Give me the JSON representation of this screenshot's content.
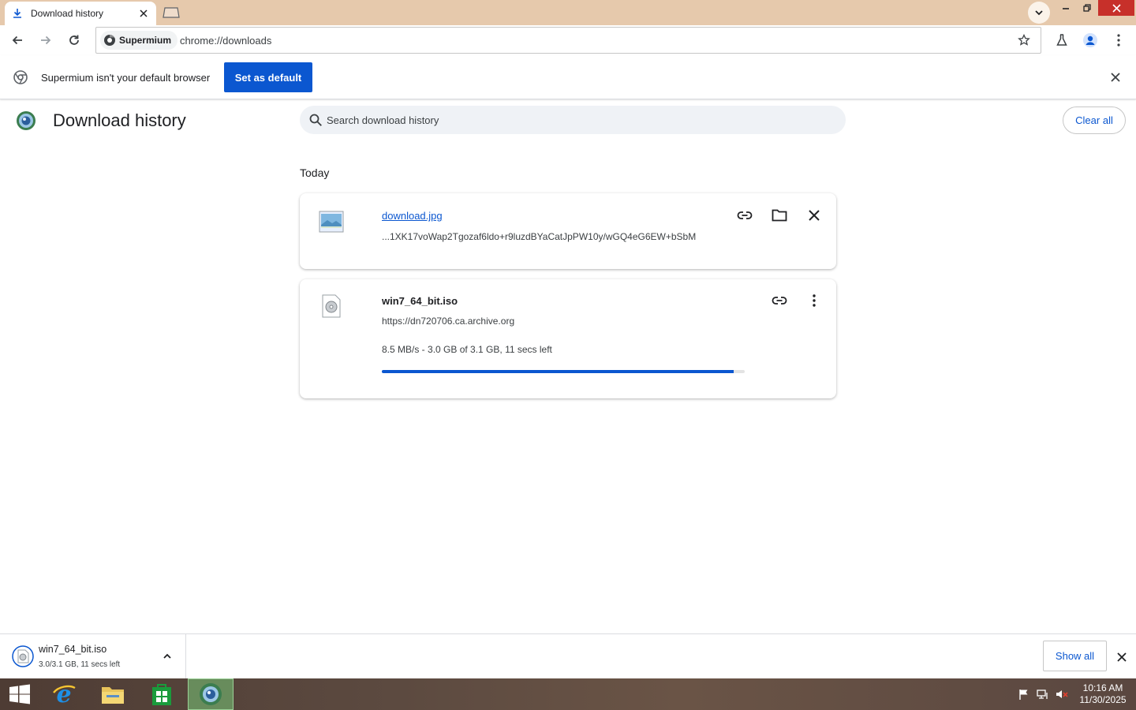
{
  "browser": {
    "tab": {
      "title": "Download history"
    },
    "omnibox": {
      "chip_label": "Supermium",
      "url": "chrome://downloads"
    }
  },
  "infobar": {
    "message": "Supermium isn't your default browser",
    "button_label": "Set as default"
  },
  "page": {
    "title": "Download history",
    "search_placeholder": "Search download history",
    "clear_all_label": "Clear all",
    "section_label": "Today"
  },
  "downloads": [
    {
      "file_name": "download.jpg",
      "url": "...1XK17voWap2Tgozaf6ldo+r9luzdBYaCatJpPW10y/wGQ4eG6EW+bSbM",
      "icon": "image-file-icon"
    },
    {
      "file_name": "win7_64_bit.iso",
      "url": "https://dn720706.ca.archive.org",
      "status": "8.5 MB/s - 3.0 GB of 3.1 GB, 11 secs left",
      "progress": 0.97,
      "icon": "disc-file-icon"
    }
  ],
  "shelf": {
    "item_name": "win7_64_bit.iso",
    "item_status": "3.0/3.1 GB, 11 secs left",
    "show_all_label": "Show all"
  },
  "taskbar": {
    "time": "10:16 AM",
    "date": "11/30/2025"
  },
  "colors": {
    "accent": "#0b57d0",
    "tabstrip": "#e6c9ac",
    "close_button": "#c7302a"
  }
}
